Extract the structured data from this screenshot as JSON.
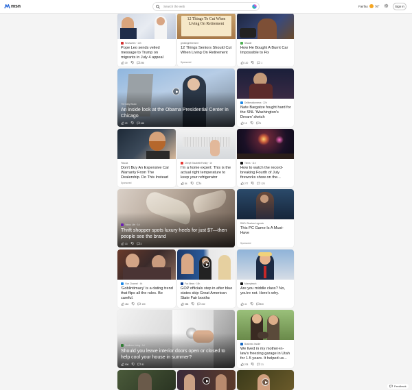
{
  "header": {
    "logo_text": "msn",
    "search_placeholder": "Search the web",
    "weather_city": "Fairfax",
    "weather_temp": "76°",
    "signin_label": "Sign in"
  },
  "cards": {
    "pope": {
      "source": "Newsweek · 14h",
      "title": "Pope Leo sends veiled message to Trump on migrants in July 4 appeal",
      "likes": "19",
      "comments": "296"
    },
    "seniors": {
      "source": "greatingretirement",
      "title": "12 Things Seniors Should Cut When Living On Retirement",
      "sponsored": "Sponsored",
      "image_text": "12 Things To Cut When Living On Retirement"
    },
    "burnt_car": {
      "source": "Silvade",
      "title": "How He Bought A Burnt Car Impossible to Fix",
      "likes": "120",
      "comments": "1"
    },
    "obama": {
      "source": "The Daily Beast",
      "title": "An inside look at the Obama Presidential Center in Chicago",
      "likes": "29",
      "comments": "168"
    },
    "nate": {
      "source": "Deliberationnews · 22h",
      "title": "Nate Bargatze fought hard for the SNL 'Washington's Dream' sketch",
      "likes": "15",
      "comments": "1"
    },
    "warranty": {
      "source": "Fiducia",
      "title": "Don't Buy An Expensive Car Warranty From The Dealership. Do This Instead",
      "sponsored": "Sponsored"
    },
    "thermostat": {
      "source": "Cheryl Elizabeth/Family · 1h",
      "title": "I'm a home expert: This is the actual right temperature to keep your refrigerator",
      "likes": "84",
      "comments": "6"
    },
    "fireworks": {
      "source": "Times · 11h",
      "title": "How to watch the record-breaking Fourth of July fireworks show on the...",
      "likes": "277",
      "comments": "123"
    },
    "heels": {
      "source": "Yahoo Life · 1d",
      "title": "Thrift shopper spots luxury heels for just $7—then people see the brand",
      "likes": "13",
      "comments": "3"
    },
    "pc_game": {
      "source": "RAID: Shadow Legends",
      "title": "This PC Game Is A Must-Have",
      "sponsored": "Sponsored"
    },
    "goblin": {
      "source": "Vice Channel · 4h",
      "title": "'Goblintimacy' is a dating trend that flips all the rules. Be careful.",
      "likes": "484",
      "comments": "130"
    },
    "gop": {
      "source": "Fox News · 10h",
      "title": "GOP officials step in after blue states skip Great American State Fair booths",
      "likes": "988",
      "comments": "242"
    },
    "middle_class": {
      "source": "Moneyteach",
      "title": "Are you middle class? No, you're not. Here's why.",
      "likes": "41",
      "comments": "830"
    },
    "doors": {
      "source": "Southern Living · 1d",
      "title": "Should you leave interior doors open or closed to help cool your house in summer?",
      "likes": "906",
      "comments": "81"
    },
    "garage": {
      "source": "Business Insider",
      "title": "We lived in my mother-in-law's freezing garage in Utah for 1.5 years. It helped us...",
      "likes": "278",
      "comments": "21"
    }
  },
  "feedback_label": "Feedback"
}
